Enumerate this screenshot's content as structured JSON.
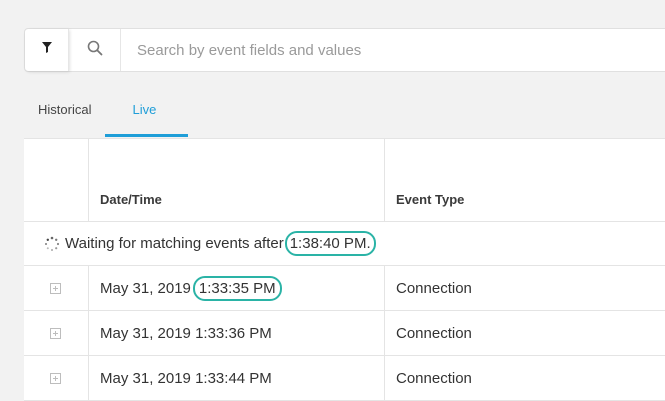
{
  "search": {
    "placeholder": "Search by event fields and values",
    "value": ""
  },
  "icons": {
    "filter": "filter-icon",
    "search": "search-icon",
    "spinner": "spinner-icon",
    "expand": "expand-row-icon"
  },
  "colors": {
    "accent": "#1f9ed8",
    "highlight": "#2ab3a6"
  },
  "tabs": [
    {
      "label": "Historical",
      "active": false
    },
    {
      "label": "Live",
      "active": true
    }
  ],
  "table": {
    "columns": [
      "Date/Time",
      "Event Type"
    ],
    "waiting": {
      "prefix": "Waiting for matching events after",
      "time": "1:38:40 PM",
      "suffix": "."
    },
    "rows": [
      {
        "date": "May 31, 2019",
        "time": "1:33:35 PM",
        "type": "Connection",
        "highlighted": true
      },
      {
        "date": "May 31, 2019",
        "time": "1:33:36 PM",
        "type": "Connection",
        "highlighted": false
      },
      {
        "date": "May 31, 2019",
        "time": "1:33:44 PM",
        "type": "Connection",
        "highlighted": false
      }
    ]
  }
}
